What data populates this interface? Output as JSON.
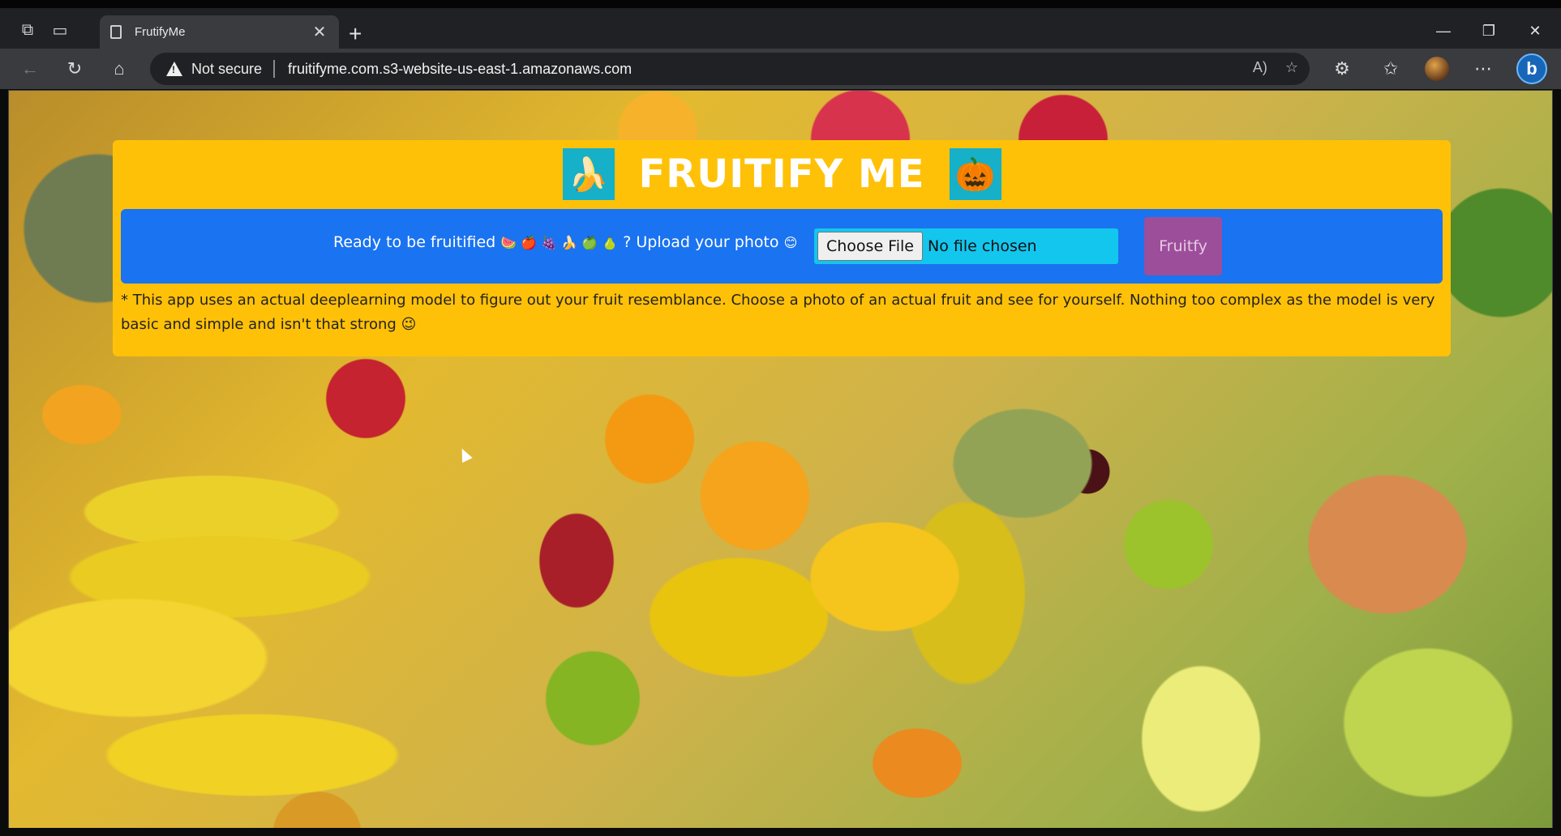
{
  "browser": {
    "tab_title": "FrutifyMe",
    "tab_close": "✕",
    "new_tab": "+",
    "security_label": "Not secure",
    "url": "fruitifyme.com.s3-website-us-east-1.amazonaws.com",
    "window": {
      "minimize": "—",
      "restore": "❐",
      "close": "✕"
    }
  },
  "page": {
    "title": "FRUITIFY ME",
    "left_gif": "🍌",
    "right_gif": "🎃",
    "upload": {
      "prompt_start": "Ready to be fruitified ",
      "fruit_emojis": "🍉 🍎 🍇 🍌 🍏 🍐",
      "prompt_end": " ? Upload your photo ",
      "smile": "😊",
      "choose_label": "Choose File",
      "file_status": "No file chosen",
      "submit_label": "Fruitfy"
    },
    "note_text": "* This app uses an actual deeplearning model to figure out your fruit resemblance. Choose a photo of an actual fruit and see for yourself. Nothing too complex as the model is very basic and simple and isn't that strong ",
    "note_emoji": "😉"
  },
  "colors": {
    "card_bg": "#ffc107",
    "upload_bg": "#1a73f0",
    "button_bg": "#9c4e9b",
    "gif_bg": "#16b0c9"
  }
}
